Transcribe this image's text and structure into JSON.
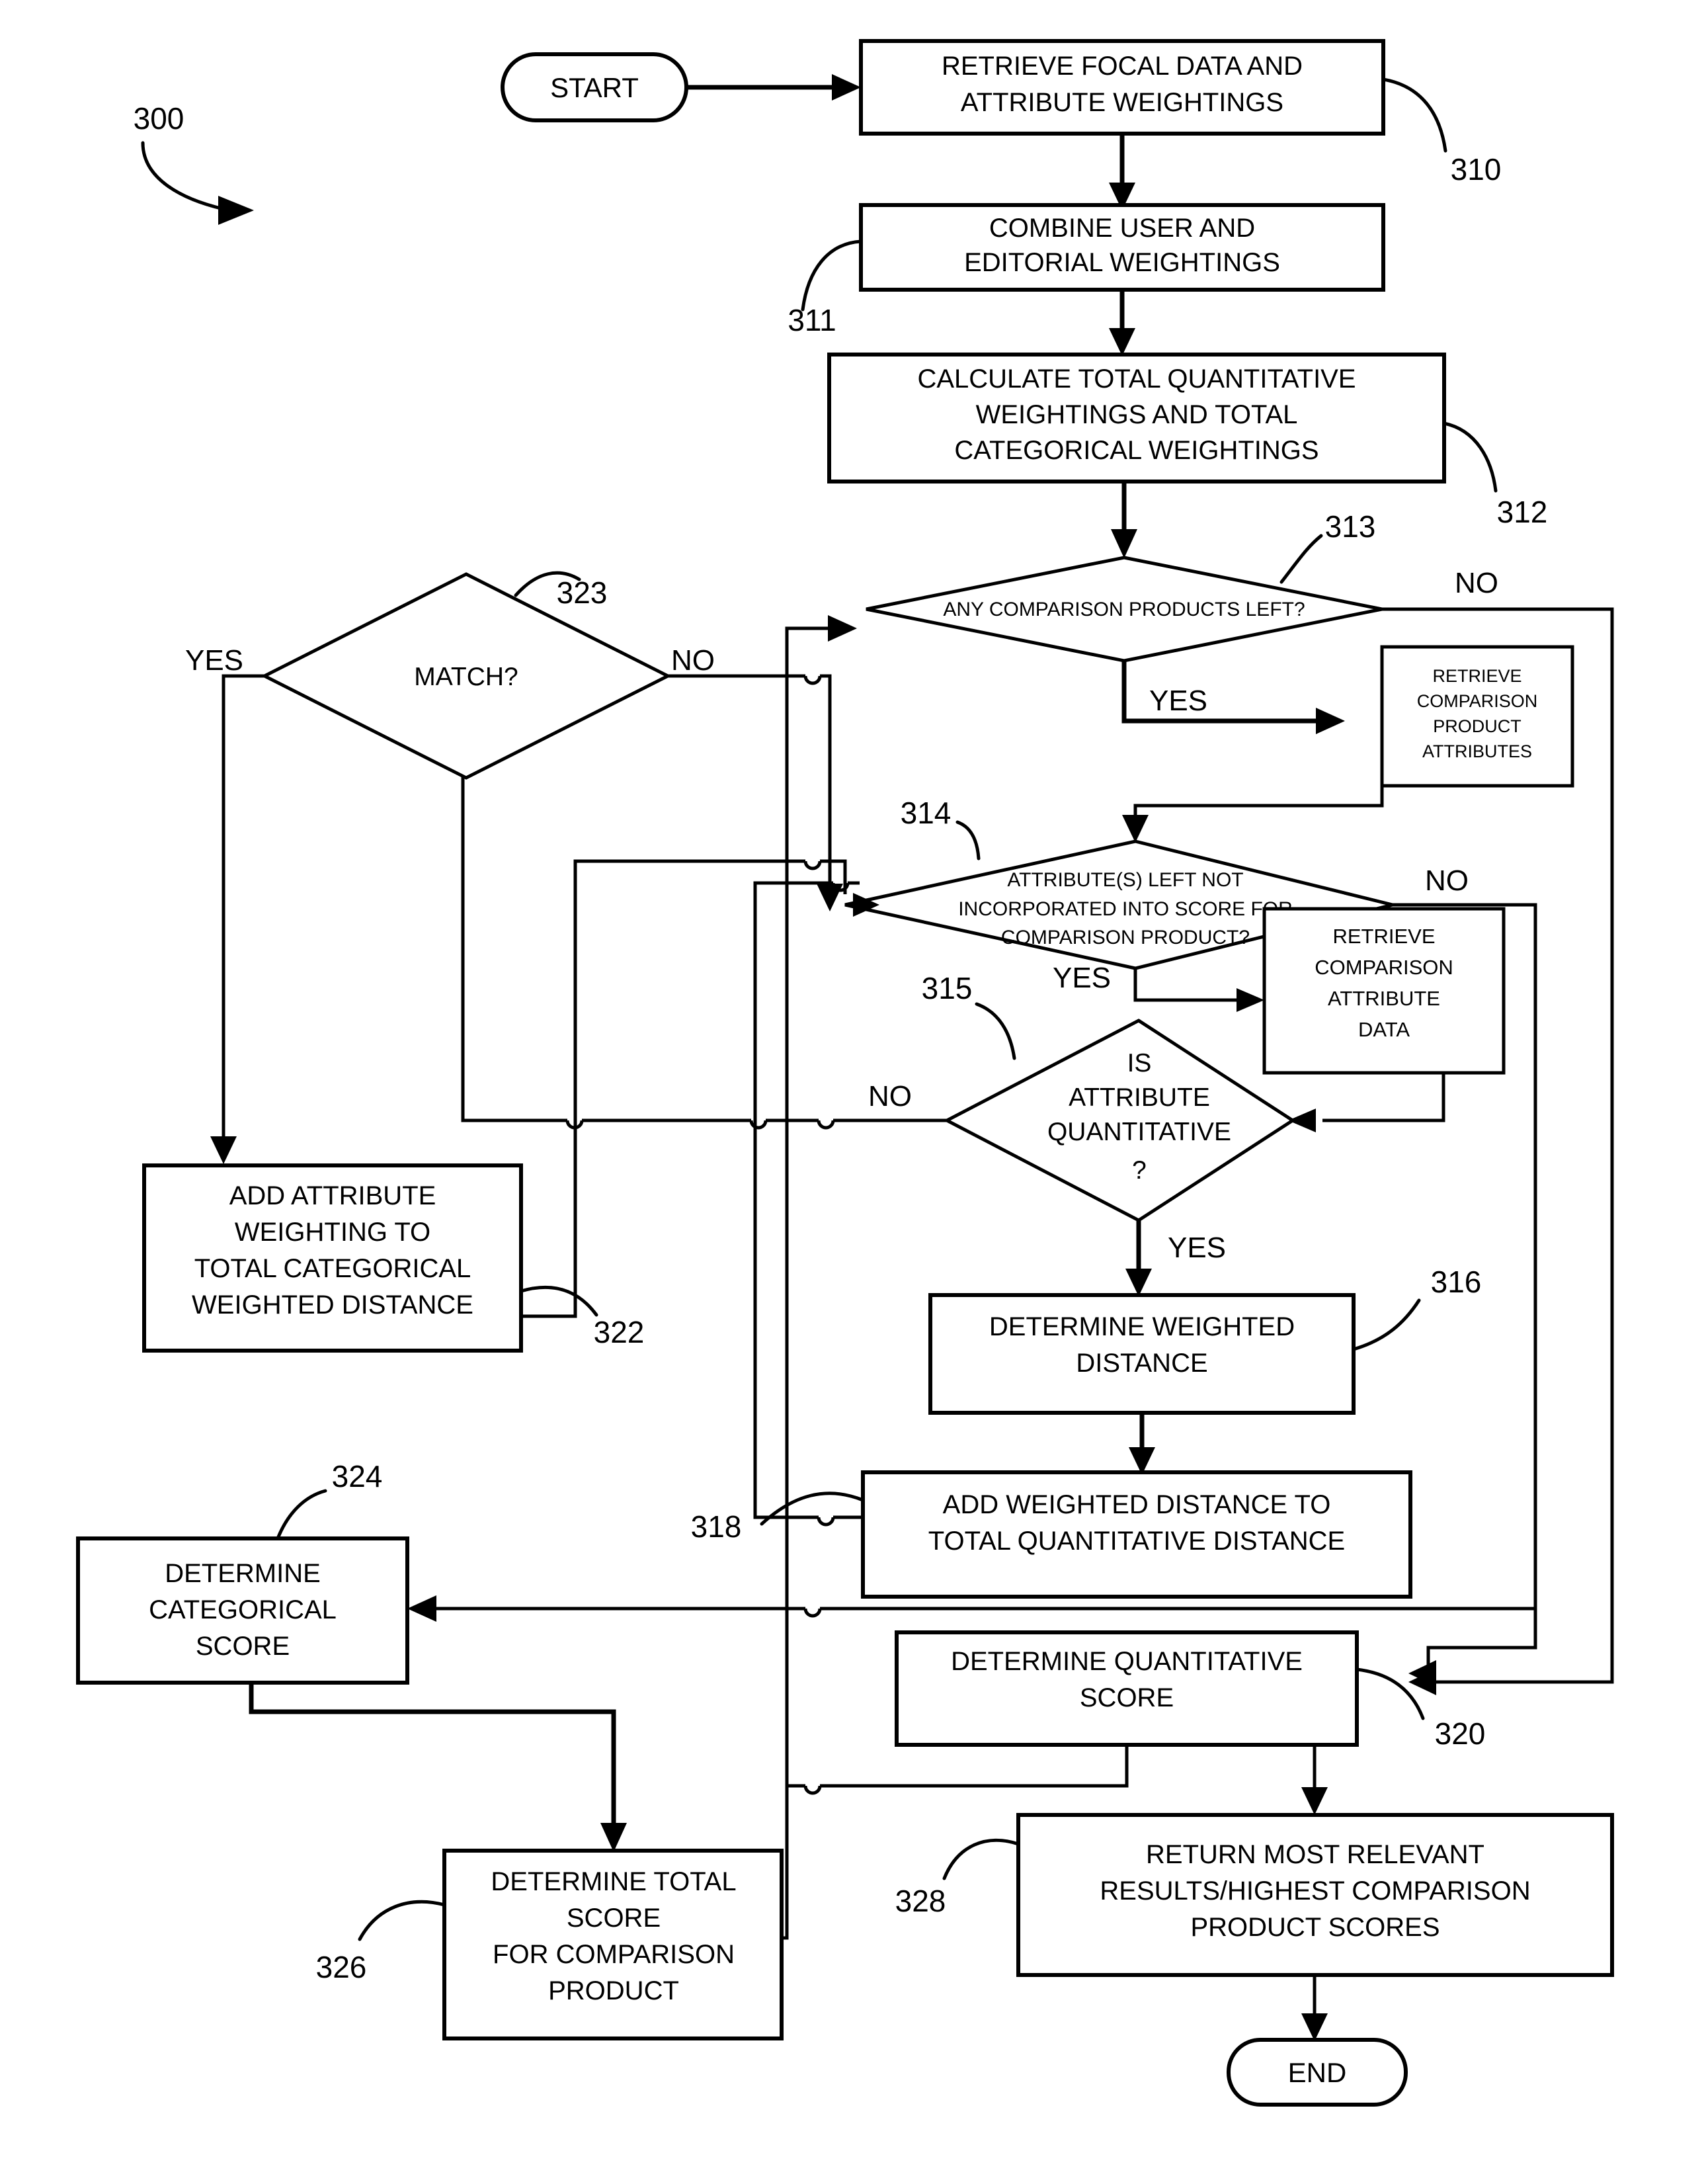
{
  "figure": {
    "ref_number": "300",
    "type": "flowchart"
  },
  "terminators": {
    "start": "START",
    "end": "END"
  },
  "process_boxes": [
    {
      "ref": "310",
      "lines": [
        "RETRIEVE FOCAL DATA AND",
        "ATTRIBUTE WEIGHTINGS"
      ]
    },
    {
      "ref": "311",
      "lines": [
        "COMBINE USER AND",
        "EDITORIAL WEIGHTINGS"
      ]
    },
    {
      "ref": "312",
      "lines": [
        "CALCULATE TOTAL QUANTITATIVE",
        "WEIGHTINGS AND TOTAL",
        "CATEGORICAL WEIGHTINGS"
      ]
    },
    {
      "ref": "",
      "lines": [
        "RETRIEVE",
        "COMPARISON",
        "PRODUCT",
        "ATTRIBUTES"
      ]
    },
    {
      "ref": "",
      "lines": [
        "RETRIEVE",
        "COMPARISON",
        "ATTRIBUTE",
        "DATA"
      ]
    },
    {
      "ref": "316",
      "lines": [
        "DETERMINE WEIGHTED",
        "DISTANCE"
      ]
    },
    {
      "ref": "318",
      "lines": [
        "ADD WEIGHTED DISTANCE TO",
        "TOTAL QUANTITATIVE DISTANCE"
      ]
    },
    {
      "ref": "322",
      "lines": [
        "ADD ATTRIBUTE",
        "WEIGHTING TO",
        "TOTAL CATEGORICAL",
        "WEIGHTED DISTANCE"
      ]
    },
    {
      "ref": "324",
      "lines": [
        "DETERMINE",
        "CATEGORICAL",
        "SCORE"
      ]
    },
    {
      "ref": "320",
      "lines": [
        "DETERMINE QUANTITATIVE",
        "SCORE"
      ]
    },
    {
      "ref": "326",
      "lines": [
        "DETERMINE TOTAL",
        "SCORE",
        "FOR COMPARISON",
        "PRODUCT"
      ]
    },
    {
      "ref": "328",
      "lines": [
        "RETURN MOST RELEVANT",
        "RESULTS/HIGHEST COMPARISON",
        "PRODUCT SCORES"
      ]
    }
  ],
  "decisions": [
    {
      "ref": "313",
      "lines": [
        "ANY COMPARISON PRODUCTS LEFT?"
      ],
      "yes": "YES",
      "no": "NO"
    },
    {
      "ref": "314",
      "lines": [
        "ATTRIBUTE(S) LEFT NOT",
        "INCORPORATED INTO  SCORE FOR",
        "COMPARISON PRODUCT?"
      ],
      "yes": "YES",
      "no": "NO"
    },
    {
      "ref": "315",
      "lines": [
        "IS",
        "ATTRIBUTE",
        "QUANTITATIVE",
        "?"
      ],
      "yes": "YES",
      "no": "NO"
    },
    {
      "ref": "323",
      "lines": [
        "MATCH?"
      ],
      "yes": "YES",
      "no": "NO"
    }
  ],
  "node_text": {
    "b310_l1": "RETRIEVE FOCAL DATA AND",
    "b310_l2": "ATTRIBUTE WEIGHTINGS",
    "b311_l1": "COMBINE USER AND",
    "b311_l2": "EDITORIAL WEIGHTINGS",
    "b312_l1": "CALCULATE TOTAL QUANTITATIVE",
    "b312_l2": "WEIGHTINGS AND TOTAL",
    "b312_l3": "CATEGORICAL WEIGHTINGS",
    "d313_l1": "ANY COMPARISON PRODUCTS LEFT?",
    "bcpa_l1": "RETRIEVE",
    "bcpa_l2": "COMPARISON",
    "bcpa_l3": "PRODUCT",
    "bcpa_l4": "ATTRIBUTES",
    "d314_l1": "ATTRIBUTE(S) LEFT NOT",
    "d314_l2": "INCORPORATED INTO  SCORE FOR",
    "d314_l3": "COMPARISON PRODUCT?",
    "bcad_l1": "RETRIEVE",
    "bcad_l2": "COMPARISON",
    "bcad_l3": "ATTRIBUTE",
    "bcad_l4": "DATA",
    "d315_l1": "IS",
    "d315_l2": "ATTRIBUTE",
    "d315_l3": "QUANTITATIVE",
    "d315_l4": "?",
    "d323_l1": "MATCH?",
    "b316_l1": "DETERMINE WEIGHTED",
    "b316_l2": "DISTANCE",
    "b318_l1": "ADD WEIGHTED DISTANCE TO",
    "b318_l2": "TOTAL QUANTITATIVE DISTANCE",
    "b322_l1": "ADD ATTRIBUTE",
    "b322_l2": "WEIGHTING TO",
    "b322_l3": "TOTAL CATEGORICAL",
    "b322_l4": "WEIGHTED DISTANCE",
    "b324_l1": "DETERMINE",
    "b324_l2": "CATEGORICAL",
    "b324_l3": "SCORE",
    "b320_l1": "DETERMINE QUANTITATIVE",
    "b320_l2": "SCORE",
    "b326_l1": "DETERMINE TOTAL",
    "b326_l2": "SCORE",
    "b326_l3": "FOR COMPARISON",
    "b326_l4": "PRODUCT",
    "b328_l1": "RETURN MOST RELEVANT",
    "b328_l2": "RESULTS/HIGHEST COMPARISON",
    "b328_l3": "PRODUCT SCORES",
    "start": "START",
    "end": "END"
  },
  "branch_labels": {
    "d313_no": "NO",
    "d313_yes": "YES",
    "d314_no": "NO",
    "d314_yes": "YES",
    "d315_no": "NO",
    "d315_yes": "YES",
    "d323_yes": "YES",
    "d323_no": "NO"
  },
  "ref_numbers": {
    "fig": "300",
    "r310": "310",
    "r311": "311",
    "r312": "312",
    "r313": "313",
    "r314": "314",
    "r315": "315",
    "r316": "316",
    "r318": "318",
    "r320": "320",
    "r322": "322",
    "r323": "323",
    "r324": "324",
    "r326": "326",
    "r328": "328"
  },
  "colors": {
    "stroke": "#000000",
    "fill": "#ffffff"
  }
}
